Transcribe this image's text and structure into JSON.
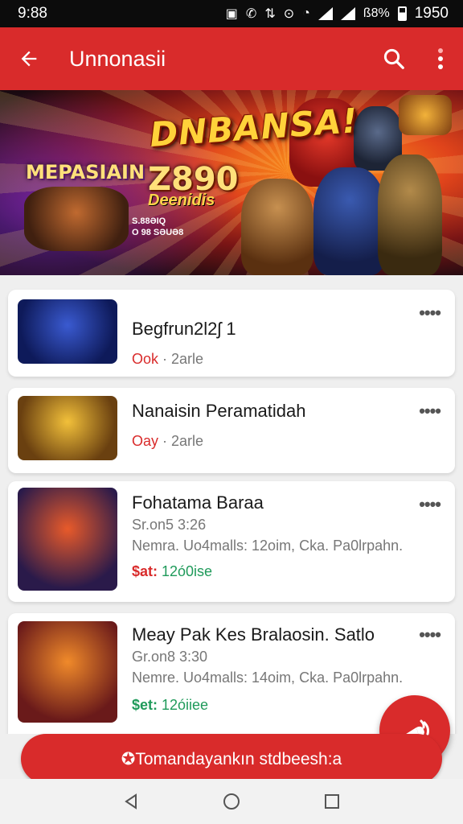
{
  "status_bar": {
    "time": "9:88",
    "battery": "ß8%",
    "clock_right": "1950"
  },
  "app_bar": {
    "back_icon": "arrow-left-icon",
    "title": "Unnonasii",
    "search_icon": "search-icon",
    "menu_icon": "more-vert-icon"
  },
  "banner": {
    "headline": "DNBANSA!",
    "left_title": "MEPASIAIN",
    "price": "Z890",
    "price_sub": "Deenidis",
    "small_line1": "S.88ƏIQ",
    "small_line2": "O 98 SƏUƏ8"
  },
  "list": [
    {
      "title": "Begfrun2l2ʃ 1",
      "meta_accent": "Ook",
      "meta_rest": " · 2arle"
    },
    {
      "title": "Nanaisin Peramatidah",
      "meta_accent": "Oay",
      "meta_rest": " · 2arle"
    },
    {
      "title": "Fohatama Baraa",
      "line1": "Sr.on5  3:26",
      "line2": "Nemra. Uo4malls:  12oim,   Cka.  Pa0lrpahn.",
      "price_label": "$at:",
      "price_value": " 12ó0ise"
    },
    {
      "title": "Meay Pak Kes Bralaosin. Satlo",
      "line1": "Gr.on8  3:30",
      "line2": "Nemre. Uo4malls:  14oim,   Cka.  Pa0lrpahn.",
      "price_label": "$et:",
      "price_value": " 12óiiee"
    }
  ],
  "cta_label": "✪Tomandayankın stdbeesh:a",
  "fab_icon": "megaphone-icon",
  "nav": {
    "back": "nav-back-icon",
    "home": "nav-home-icon",
    "recents": "nav-recents-icon"
  },
  "colors": {
    "primary": "#d92b2b",
    "price_green": "#1f9a5a"
  }
}
